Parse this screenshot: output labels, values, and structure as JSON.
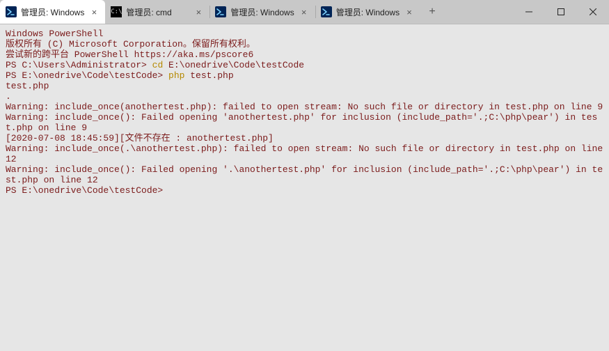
{
  "tabs": [
    {
      "icon": "powershell",
      "label": "管理员: Windows",
      "active": true
    },
    {
      "icon": "cmd",
      "label": "管理员: cmd",
      "active": false
    },
    {
      "icon": "powershell",
      "label": "管理员: Windows",
      "active": false
    },
    {
      "icon": "powershell",
      "label": "管理员: Windows",
      "active": false
    }
  ],
  "newtab_glyph": "+",
  "close_glyph": "×",
  "terminal": {
    "lines": [
      {
        "t": "Windows PowerShell"
      },
      {
        "t": "版权所有 (C) Microsoft Corporation。保留所有权利。"
      },
      {
        "t": ""
      },
      {
        "t": "尝试新的跨平台 PowerShell https://aka.ms/pscore6"
      },
      {
        "t": ""
      },
      {
        "prompt": "PS C:\\Users\\Administrator> ",
        "cmd": "cd",
        "args": " E:\\onedrive\\Code\\testCode"
      },
      {
        "prompt": "PS E:\\onedrive\\Code\\testCode> ",
        "cmd": "php",
        "args": " test.php"
      },
      {
        "t": ""
      },
      {
        "t": "test.php"
      },
      {
        "t": "."
      },
      {
        "t": ""
      },
      {
        "t": ""
      },
      {
        "t": "Warning: include_once(anothertest.php): failed to open stream: No such file or directory in test.php on line 9"
      },
      {
        "t": ""
      },
      {
        "t": "Warning: include_once(): Failed opening 'anothertest.php' for inclusion (include_path='.;C:\\php\\pear') in test.php on line 9"
      },
      {
        "t": "[2020-07-08 18:45:59][文件不存在 : anothertest.php]"
      },
      {
        "t": ""
      },
      {
        "t": "Warning: include_once(.\\anothertest.php): failed to open stream: No such file or directory in test.php on line 12"
      },
      {
        "t": ""
      },
      {
        "t": "Warning: include_once(): Failed opening '.\\anothertest.php' for inclusion (include_path='.;C:\\php\\pear') in test.php on line 12"
      },
      {
        "prompt": "PS E:\\onedrive\\Code\\testCode>",
        "cmd": "",
        "args": ""
      }
    ]
  },
  "colors": {
    "terminal_bg": "#e6e6e6",
    "terminal_fg": "#7b1b1b",
    "cmd_highlight": "#b58900",
    "tab_active_bg": "#ffffff",
    "titlebar_bg": "#c8c8c8"
  }
}
